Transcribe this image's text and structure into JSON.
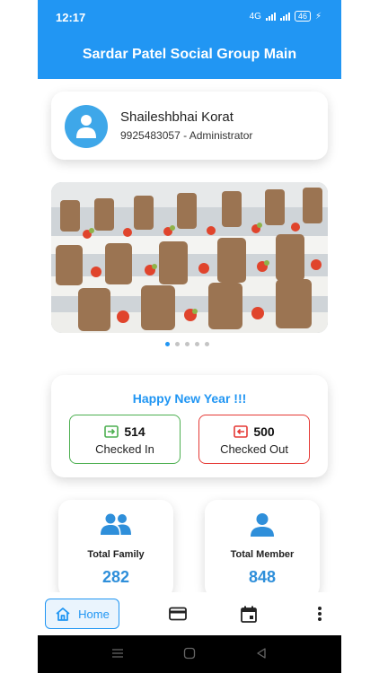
{
  "status_bar": {
    "time": "12:17",
    "network_label": "4G",
    "battery": "46"
  },
  "app": {
    "title": "Sardar Patel Social Group Main"
  },
  "profile": {
    "name": "Shaileshbhai Korat",
    "details": "9925483057 - Administrator"
  },
  "banner": {
    "slide_count": 5,
    "active_slide": 1
  },
  "greeting": {
    "title": "Happy New Year !!!",
    "checked_in": {
      "count": "514",
      "label": "Checked In"
    },
    "checked_out": {
      "count": "500",
      "label": "Checked Out"
    }
  },
  "stats": [
    {
      "label": "Total Family",
      "value": "282",
      "icon": "family-group-icon"
    },
    {
      "label": "Total Member",
      "value": "848",
      "icon": "person-icon"
    }
  ],
  "bottom_nav": {
    "home_label": "Home",
    "items": [
      "home-icon",
      "card-icon",
      "calendar-icon",
      "more-vert-icon"
    ]
  },
  "colors": {
    "primary": "#2196f3",
    "checked_in": "#4caf50",
    "checked_out": "#e53935",
    "stat_value": "#2f8fda"
  }
}
